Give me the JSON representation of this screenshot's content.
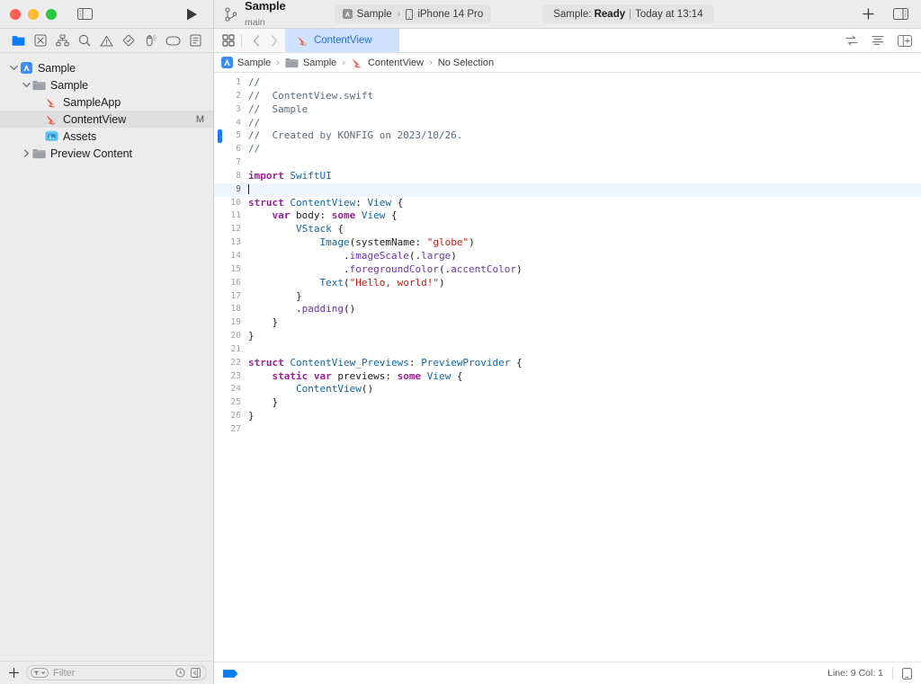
{
  "window": {
    "traffic_lights": [
      "close",
      "minimize",
      "zoom"
    ],
    "sidebar_toggle": "toggle-navigator",
    "run_button": "run"
  },
  "toolbar": {
    "scheme_name": "Sample",
    "branch_name": "main",
    "destination": {
      "scheme": "Sample",
      "separator": "›",
      "device": "iPhone 14 Pro"
    },
    "status": {
      "prefix": "Sample:",
      "state": "Ready",
      "separator": "|",
      "time": "Today at 13:14"
    },
    "add_button": "+",
    "inspector_toggle": "toggle-inspector"
  },
  "navigator": {
    "toolbar_icons": [
      "project-navigator-icon",
      "source-control-navigator-icon",
      "symbol-navigator-icon",
      "find-navigator-icon",
      "issue-navigator-icon",
      "test-navigator-icon",
      "debug-navigator-icon",
      "breakpoint-navigator-icon",
      "report-navigator-icon"
    ],
    "tree": [
      {
        "label": "Sample",
        "indent": 0,
        "icon": "xcode-project-icon",
        "twisty": "down",
        "selected": false,
        "badge": ""
      },
      {
        "label": "Sample",
        "indent": 1,
        "icon": "folder-icon",
        "twisty": "down",
        "selected": false,
        "badge": ""
      },
      {
        "label": "SampleApp",
        "indent": 2,
        "icon": "swift-file-icon",
        "twisty": "none",
        "selected": false,
        "badge": ""
      },
      {
        "label": "ContentView",
        "indent": 2,
        "icon": "swift-file-icon",
        "twisty": "none",
        "selected": true,
        "badge": "M"
      },
      {
        "label": "Assets",
        "indent": 2,
        "icon": "assets-catalog-icon",
        "twisty": "none",
        "selected": false,
        "badge": ""
      },
      {
        "label": "Preview Content",
        "indent": 1,
        "icon": "folder-icon",
        "twisty": "right",
        "selected": false,
        "badge": ""
      }
    ],
    "filter": {
      "add_button": "+",
      "placeholder": "Filter",
      "recent_icon": "clock-icon",
      "collapse_icon": "collapse-icon"
    }
  },
  "editor": {
    "tab": {
      "label": "ContentView",
      "icon": "swift-file-icon"
    },
    "tab_nav": {
      "back": "‹",
      "forward": "›",
      "grid": "editor-options-icon"
    },
    "tabbar_right_icons": [
      "code-review-icon",
      "minimap-icon",
      "add-editor-icon"
    ],
    "breadcrumb": [
      {
        "label": "Sample",
        "icon": "xcode-project-icon"
      },
      {
        "label": "Sample",
        "icon": "folder-icon"
      },
      {
        "label": "ContentView",
        "icon": "swift-file-icon"
      },
      {
        "label": "No Selection",
        "icon": "none"
      }
    ],
    "breadcrumb_separator": "›",
    "current_line": 9,
    "status": {
      "line_col": "Line: 9  Col: 1",
      "left_icon": "breakpoint-icon",
      "right_icon": "preview-device-icon"
    },
    "code": [
      {
        "n": 1,
        "mark": false,
        "tokens": [
          {
            "t": "cmt",
            "s": "//"
          }
        ]
      },
      {
        "n": 2,
        "mark": false,
        "tokens": [
          {
            "t": "cmt",
            "s": "//  ContentView.swift"
          }
        ]
      },
      {
        "n": 3,
        "mark": false,
        "tokens": [
          {
            "t": "cmt",
            "s": "//  Sample"
          }
        ]
      },
      {
        "n": 4,
        "mark": false,
        "tokens": [
          {
            "t": "cmt",
            "s": "//"
          }
        ]
      },
      {
        "n": 5,
        "mark": true,
        "tokens": [
          {
            "t": "cmt",
            "s": "//  Created by KONFIG on 2023/10/26."
          }
        ]
      },
      {
        "n": 6,
        "mark": false,
        "tokens": [
          {
            "t": "cmt",
            "s": "//"
          }
        ]
      },
      {
        "n": 7,
        "mark": false,
        "tokens": []
      },
      {
        "n": 8,
        "mark": false,
        "tokens": [
          {
            "t": "kw",
            "s": "import"
          },
          {
            "t": "plain",
            "s": " "
          },
          {
            "t": "type",
            "s": "SwiftUI"
          }
        ]
      },
      {
        "n": 9,
        "mark": false,
        "tokens": [],
        "cursor": true
      },
      {
        "n": 10,
        "mark": false,
        "tokens": [
          {
            "t": "kw",
            "s": "struct"
          },
          {
            "t": "plain",
            "s": " "
          },
          {
            "t": "type",
            "s": "ContentView"
          },
          {
            "t": "plain",
            "s": ": "
          },
          {
            "t": "type",
            "s": "View"
          },
          {
            "t": "plain",
            "s": " {"
          }
        ]
      },
      {
        "n": 11,
        "mark": false,
        "tokens": [
          {
            "t": "plain",
            "s": "    "
          },
          {
            "t": "kw",
            "s": "var"
          },
          {
            "t": "plain",
            "s": " body: "
          },
          {
            "t": "kw",
            "s": "some"
          },
          {
            "t": "plain",
            "s": " "
          },
          {
            "t": "type",
            "s": "View"
          },
          {
            "t": "plain",
            "s": " {"
          }
        ]
      },
      {
        "n": 12,
        "mark": false,
        "tokens": [
          {
            "t": "plain",
            "s": "        "
          },
          {
            "t": "type",
            "s": "VStack"
          },
          {
            "t": "plain",
            "s": " {"
          }
        ]
      },
      {
        "n": 13,
        "mark": false,
        "tokens": [
          {
            "t": "plain",
            "s": "            "
          },
          {
            "t": "type",
            "s": "Image"
          },
          {
            "t": "plain",
            "s": "(systemName: "
          },
          {
            "t": "str",
            "s": "\"globe\""
          },
          {
            "t": "plain",
            "s": ")"
          }
        ]
      },
      {
        "n": 14,
        "mark": false,
        "tokens": [
          {
            "t": "plain",
            "s": "                ."
          },
          {
            "t": "call",
            "s": "imageScale"
          },
          {
            "t": "plain",
            "s": "(."
          },
          {
            "t": "mem",
            "s": "large"
          },
          {
            "t": "plain",
            "s": ")"
          }
        ]
      },
      {
        "n": 15,
        "mark": false,
        "tokens": [
          {
            "t": "plain",
            "s": "                ."
          },
          {
            "t": "call",
            "s": "foregroundColor"
          },
          {
            "t": "plain",
            "s": "(."
          },
          {
            "t": "mem",
            "s": "accentColor"
          },
          {
            "t": "plain",
            "s": ")"
          }
        ]
      },
      {
        "n": 16,
        "mark": false,
        "tokens": [
          {
            "t": "plain",
            "s": "            "
          },
          {
            "t": "type",
            "s": "Text"
          },
          {
            "t": "plain",
            "s": "("
          },
          {
            "t": "str",
            "s": "\"Hello, world!\""
          },
          {
            "t": "plain",
            "s": ")"
          }
        ]
      },
      {
        "n": 17,
        "mark": false,
        "tokens": [
          {
            "t": "plain",
            "s": "        }"
          }
        ]
      },
      {
        "n": 18,
        "mark": false,
        "tokens": [
          {
            "t": "plain",
            "s": "        ."
          },
          {
            "t": "call",
            "s": "padding"
          },
          {
            "t": "plain",
            "s": "()"
          }
        ]
      },
      {
        "n": 19,
        "mark": false,
        "tokens": [
          {
            "t": "plain",
            "s": "    }"
          }
        ]
      },
      {
        "n": 20,
        "mark": false,
        "tokens": [
          {
            "t": "plain",
            "s": "}"
          }
        ]
      },
      {
        "n": 21,
        "mark": false,
        "tokens": []
      },
      {
        "n": 22,
        "mark": false,
        "tokens": [
          {
            "t": "kw",
            "s": "struct"
          },
          {
            "t": "plain",
            "s": " "
          },
          {
            "t": "type",
            "s": "ContentView_Previews"
          },
          {
            "t": "plain",
            "s": ": "
          },
          {
            "t": "type",
            "s": "PreviewProvider"
          },
          {
            "t": "plain",
            "s": " {"
          }
        ]
      },
      {
        "n": 23,
        "mark": false,
        "tokens": [
          {
            "t": "plain",
            "s": "    "
          },
          {
            "t": "kw",
            "s": "static var"
          },
          {
            "t": "plain",
            "s": " previews: "
          },
          {
            "t": "kw",
            "s": "some"
          },
          {
            "t": "plain",
            "s": " "
          },
          {
            "t": "type",
            "s": "View"
          },
          {
            "t": "plain",
            "s": " {"
          }
        ]
      },
      {
        "n": 24,
        "mark": false,
        "tokens": [
          {
            "t": "plain",
            "s": "        "
          },
          {
            "t": "type",
            "s": "ContentView"
          },
          {
            "t": "plain",
            "s": "()"
          }
        ]
      },
      {
        "n": 25,
        "mark": false,
        "tokens": [
          {
            "t": "plain",
            "s": "    }"
          }
        ]
      },
      {
        "n": 26,
        "mark": false,
        "tokens": [
          {
            "t": "plain",
            "s": "}"
          }
        ]
      },
      {
        "n": 27,
        "mark": false,
        "tokens": []
      }
    ]
  },
  "colors": {
    "accent_blue": "#0a7cf4",
    "tab_selected_bg": "#cfe2fb",
    "tab_selected_text": "#2a6fd4",
    "swift_orange": "#f05138",
    "current_line_bg": "#f0f5fd",
    "edit_marker_blue": "#1f7af0",
    "chrome_bg": "#ececec"
  }
}
